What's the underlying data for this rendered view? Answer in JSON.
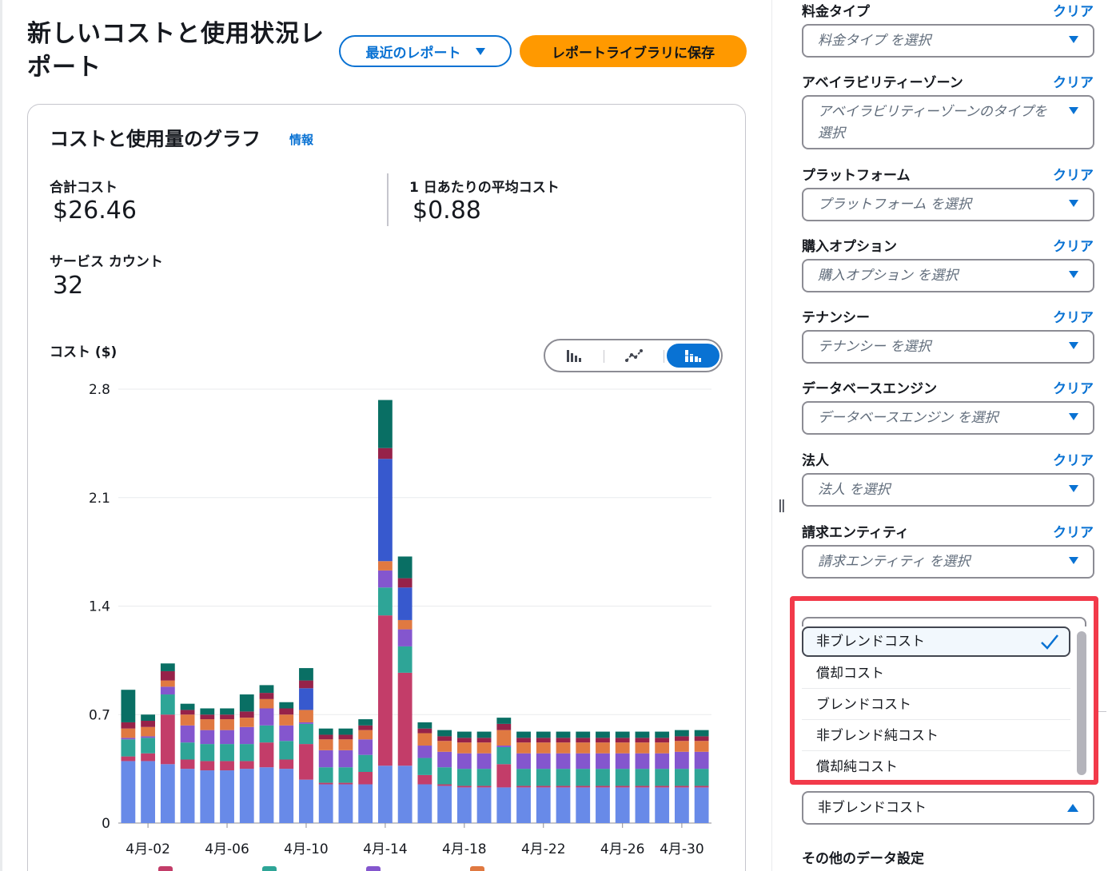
{
  "header": {
    "title": "新しいコストと使用状況レポート",
    "recent_reports_label": "最近のレポート",
    "save_to_library_label": "レポートライブラリに保存"
  },
  "summary_card": {
    "title": "コストと使用量のグラフ",
    "info_label": "情報",
    "total_cost_label": "合計コスト",
    "total_cost_value": "$26.46",
    "avg_daily_label": "1 日あたりの平均コスト",
    "avg_daily_value": "$0.88",
    "service_count_label": "サービス カウント",
    "service_count_value": "32",
    "axis_title": "コスト ($)",
    "chart_type_toggle": [
      "bar-chart-icon",
      "line-chart-icon",
      "stacked-bar-chart-icon"
    ],
    "chart_type_selected": "stacked-bar-chart-icon"
  },
  "chart_data": {
    "type": "bar",
    "stacked": true,
    "ylim": [
      0,
      2.8
    ],
    "yticks": [
      "0",
      "0.7",
      "1.4",
      "2.1",
      "2.8"
    ],
    "x_tick_labels": [
      "4月-02",
      "4月-06",
      "4月-10",
      "4月-14",
      "4月-18",
      "4月-22",
      "4月-26",
      "4月-30"
    ],
    "x_tick_indices": [
      1,
      5,
      9,
      13,
      17,
      21,
      25,
      28
    ],
    "colors": [
      "#688ae8",
      "#c33d69",
      "#2ea597",
      "#8456ce",
      "#e07941",
      "#3759ce",
      "#962249",
      "#096f64",
      "#6237a7",
      "#a84401",
      "#273ea5",
      "#780d35",
      "#03524a",
      "#4a238b",
      "#7e3103",
      "#1b2b88",
      "#ce567c",
      "#003e38",
      "#9469d6",
      "#602400",
      "#0c5cb2",
      "#a2780f"
    ],
    "series": [
      {
        "values": [
          0.4,
          0.4,
          0.38,
          0.35,
          0.34,
          0.34,
          0.35,
          0.36,
          0.35,
          0.28,
          0.25,
          0.25,
          0.25,
          0.37,
          0.37,
          0.25,
          0.24,
          0.23,
          0.23,
          0.23,
          0.23,
          0.23,
          0.23,
          0.23,
          0.23,
          0.23,
          0.23,
          0.23,
          0.23,
          0.23
        ]
      },
      {
        "values": [
          0.03,
          0.05,
          0.32,
          0.06,
          0.06,
          0.06,
          0.05,
          0.16,
          0.06,
          0.23,
          0.01,
          0.01,
          0.08,
          0.97,
          0.6,
          0.06,
          0.01,
          0.01,
          0.01,
          0.15,
          0.01,
          0.01,
          0.01,
          0.01,
          0.01,
          0.01,
          0.01,
          0.01,
          0.01,
          0.01
        ]
      },
      {
        "values": [
          0.11,
          0.1,
          0.13,
          0.11,
          0.11,
          0.11,
          0.11,
          0.11,
          0.12,
          0.13,
          0.1,
          0.1,
          0.11,
          0.18,
          0.17,
          0.11,
          0.11,
          0.11,
          0.11,
          0.11,
          0.11,
          0.11,
          0.11,
          0.11,
          0.11,
          0.11,
          0.11,
          0.11,
          0.11,
          0.11
        ]
      },
      {
        "values": [
          0.01,
          0.01,
          0.05,
          0.11,
          0.09,
          0.09,
          0.11,
          0.11,
          0.1,
          0.01,
          0.11,
          0.11,
          0.1,
          0.11,
          0.11,
          0.08,
          0.1,
          0.1,
          0.1,
          0.01,
          0.1,
          0.1,
          0.1,
          0.1,
          0.1,
          0.1,
          0.1,
          0.1,
          0.11,
          0.11
        ]
      },
      {
        "values": [
          0.06,
          0.06,
          0.04,
          0.07,
          0.07,
          0.07,
          0.06,
          0.06,
          0.07,
          0.08,
          0.07,
          0.07,
          0.06,
          0.06,
          0.06,
          0.08,
          0.07,
          0.07,
          0.07,
          0.1,
          0.07,
          0.07,
          0.07,
          0.07,
          0.07,
          0.07,
          0.07,
          0.07,
          0.07,
          0.07
        ]
      },
      {
        "values": [
          0,
          0,
          0,
          0,
          0,
          0,
          0,
          0,
          0,
          0.14,
          0,
          0,
          0,
          0.66,
          0.21,
          0,
          0,
          0,
          0,
          0,
          0,
          0,
          0,
          0,
          0,
          0,
          0,
          0,
          0,
          0
        ]
      },
      {
        "values": [
          0.04,
          0.04,
          0.06,
          0.03,
          0.03,
          0.03,
          0.04,
          0.04,
          0.04,
          0.05,
          0.03,
          0.03,
          0.03,
          0.07,
          0.06,
          0.03,
          0.03,
          0.03,
          0.03,
          0.04,
          0.03,
          0.03,
          0.03,
          0.03,
          0.03,
          0.03,
          0.03,
          0.03,
          0.03,
          0.03
        ]
      },
      {
        "values": [
          0.21,
          0.04,
          0.05,
          0.04,
          0.04,
          0.04,
          0.11,
          0.05,
          0.04,
          0.08,
          0.04,
          0.04,
          0.04,
          0.31,
          0.14,
          0.04,
          0.04,
          0.04,
          0.04,
          0.04,
          0.04,
          0.04,
          0.04,
          0.04,
          0.04,
          0.04,
          0.04,
          0.04,
          0.04,
          0.04
        ]
      }
    ]
  },
  "filters": [
    {
      "label": "料金タイプ",
      "clear_label": "クリア",
      "placeholder": "料金タイプ を選択"
    },
    {
      "label": "アベイラビリティーゾーン",
      "clear_label": "クリア",
      "placeholder": "アベイラビリティーゾーンのタイプを選択"
    },
    {
      "label": "プラットフォーム",
      "clear_label": "クリア",
      "placeholder": "プラットフォーム を選択"
    },
    {
      "label": "購入オプション",
      "clear_label": "クリア",
      "placeholder": "購入オプション を選択"
    },
    {
      "label": "テナンシー",
      "clear_label": "クリア",
      "placeholder": "テナンシー を選択"
    },
    {
      "label": "データベースエンジン",
      "clear_label": "クリア",
      "placeholder": "データベースエンジン を選択"
    },
    {
      "label": "法人",
      "clear_label": "クリア",
      "placeholder": "法人 を選択"
    },
    {
      "label": "請求エンティティ",
      "clear_label": "クリア",
      "placeholder": "請求エンティティ を選択"
    }
  ],
  "cost_type_dropdown": {
    "options": [
      "非ブレンドコスト",
      "償却コスト",
      "ブレンドコスト",
      "非ブレンド純コスト",
      "償却純コスト"
    ],
    "selected": "非ブレンドコスト",
    "selected_value": "非ブレンドコスト"
  },
  "other_settings_label": "その他のデータ設定",
  "accent_color": "#0972d3",
  "highlight_color": "#f23a4a"
}
